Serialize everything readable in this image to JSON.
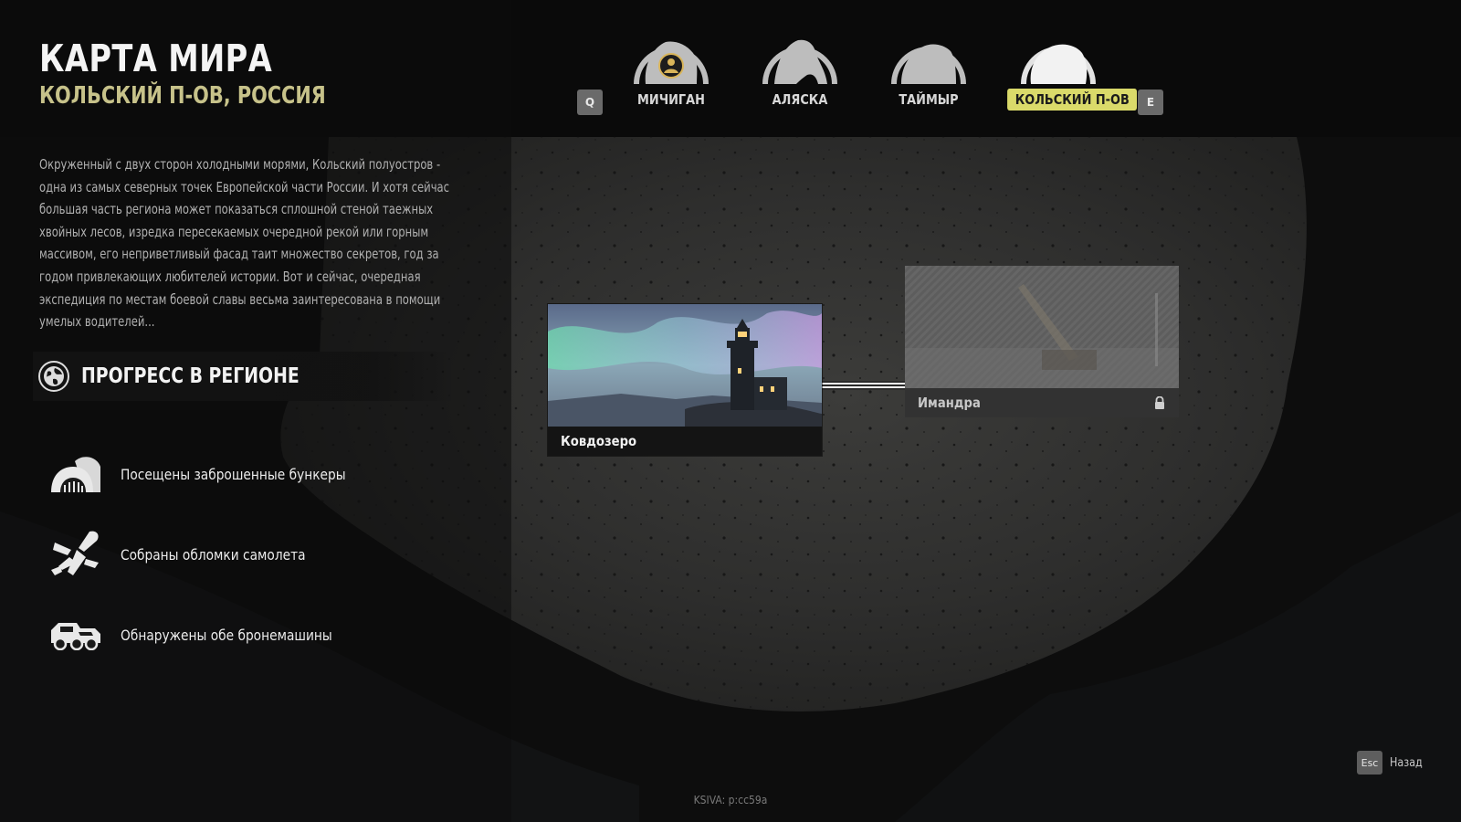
{
  "header": {
    "title": "КАРТА МИРА",
    "subtitle": "КОЛЬСКИЙ П-ОВ, РОССИЯ"
  },
  "description": "Окруженный с двух сторон холодными морями, Кольский полуостров - одна из самых северных точек Европейской части России. И хотя сейчас большая часть региона может показаться сплошной стеной таежных хвойных лесов, изредка пересекаемых очередной рекой или горным массивом, его неприветливый фасад таит множество секретов, год за годом привлекающих любителей истории. Вот и сейчас, очередная экспедиция по местам боевой славы весьма заинтересована в помощи умелых водителей...",
  "progress": {
    "title": "ПРОГРЕСС В РЕГИОНЕ",
    "icon": "globe-icon",
    "items": [
      {
        "icon": "bunker-icon",
        "label": "Посещены заброшенные бункеры"
      },
      {
        "icon": "plane-wreck-icon",
        "label": "Собраны обломки самолета"
      },
      {
        "icon": "armored-vehicle-icon",
        "label": "Обнаружены обе бронемашины"
      }
    ]
  },
  "region_nav": {
    "prev_key": "Q",
    "next_key": "E",
    "tabs": [
      {
        "label": "МИЧИГАН",
        "active": false,
        "has_avatar": true
      },
      {
        "label": "АЛЯСКА",
        "active": false
      },
      {
        "label": "ТАЙМЫР",
        "active": false
      },
      {
        "label": "КОЛЬСКИЙ П-ОВ",
        "active": true
      }
    ]
  },
  "locations": [
    {
      "name": "Ковдозеро",
      "locked": false
    },
    {
      "name": "Имандра",
      "locked": true
    }
  ],
  "footer": {
    "back_key": "Esc",
    "back_label": "Назад",
    "build": "KSIVA: p:cc59a"
  },
  "colors": {
    "accent": "#dada6a",
    "subtitle": "#c7c28a",
    "background": "#0c0c0c"
  }
}
